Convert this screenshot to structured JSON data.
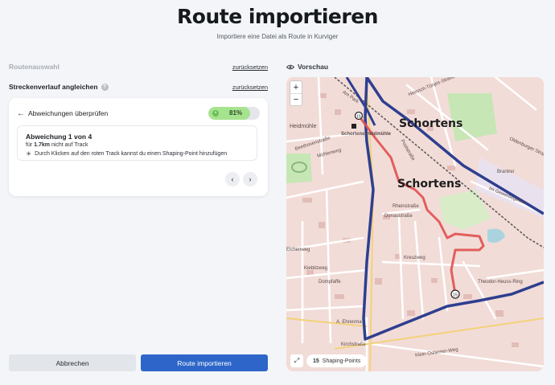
{
  "header": {
    "title": "Route importieren",
    "subtitle": "Importiere eine Datei als Route in Kurviger"
  },
  "sections": {
    "route_selection": {
      "label": "Routenauswahl",
      "reset": "zurücksetzen"
    },
    "track_matching": {
      "label": "Streckenverlauf angleichen",
      "reset": "zurücksetzen"
    }
  },
  "card": {
    "back_title": "Abweichungen überprüfen",
    "progress": {
      "percent_label": "81%",
      "fraction": 0.81
    },
    "deviation": {
      "title": "Abweichung 1 von 4",
      "prefix": "für",
      "distance": "1.7km",
      "suffix": "nicht auf Track",
      "hint": "Durch Klicken auf den roten Track kannst du einen Shaping-Point hinzufügen"
    },
    "nav": {
      "prev": "‹",
      "next": "›"
    }
  },
  "buttons": {
    "cancel": "Abbrechen",
    "import": "Route importieren"
  },
  "preview": {
    "label": "Vorschau",
    "zoom_in": "+",
    "zoom_out": "−",
    "shaping_count": "15",
    "shaping_label": "Shaping-Points",
    "places": {
      "town_top": "Schortens",
      "town_center": "Schortens",
      "station": "Schortens-Heidmühle"
    },
    "streets": {
      "heidmuehle": "Heidmühle",
      "beethoven": "Beethovenstraße",
      "muehlenweg": "Mühlenweg",
      "gewerbegebiet": "Im Gewerbegebiet",
      "brantrei": "Brantrei",
      "donau": "Donaustraße",
      "kreuzweg": "Kreuzweg",
      "theodor": "Theodor-Heuss-Ring",
      "oldenburger": "Oldenburger Straße",
      "kirchstr": "Kirchstraße",
      "klein_ostiemer": "Klein-Ostiemer-Weg",
      "kiebitz": "Kiebitzweg",
      "dompfaffe": "Dompfaffe",
      "ehrenma": "A. Ehrenma",
      "eichenweg": "Eichenweg",
      "heinrich": "Heinrich-Tönjes-Straße",
      "am_park": "Am Park",
      "postst": "Poststraße",
      "rheinstr": "Rheinstraße"
    },
    "colors": {
      "route_blue": "#2e3f8f",
      "deviation_red": "#e05050",
      "rail": "#555555",
      "park": "#c7e6b5",
      "water": "#aad3df"
    }
  }
}
